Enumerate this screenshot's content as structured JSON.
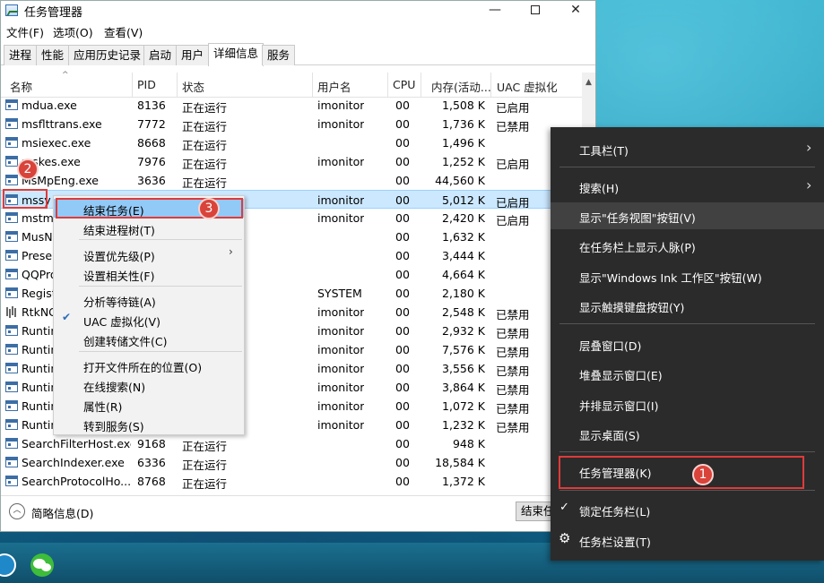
{
  "window": {
    "title": "任务管理器",
    "controls": {
      "minimize": "—",
      "maximize": "",
      "close": "✕"
    }
  },
  "menubar": [
    "文件(F)",
    "选项(O)",
    "查看(V)"
  ],
  "tabs": [
    "进程",
    "性能",
    "应用历史记录",
    "启动",
    "用户",
    "详细信息",
    "服务"
  ],
  "active_tab": "详细信息",
  "table": {
    "columns": [
      "名称",
      "PID",
      "状态",
      "用户名",
      "CPU",
      "内存(活动...",
      "UAC 虚拟化"
    ],
    "rows": [
      {
        "name": "mdua.exe",
        "pid": "8136",
        "status": "正在运行",
        "user": "imonitor",
        "cpu": "00",
        "mem": "1,508 K",
        "uac": "已启用"
      },
      {
        "name": "msflttrans.exe",
        "pid": "7772",
        "status": "正在运行",
        "user": "imonitor",
        "cpu": "00",
        "mem": "1,736 K",
        "uac": "已禁用"
      },
      {
        "name": "msiexec.exe",
        "pid": "8668",
        "status": "正在运行",
        "user": "",
        "cpu": "00",
        "mem": "1,496 K",
        "uac": ""
      },
      {
        "name": "mskes.exe",
        "pid": "7976",
        "status": "正在运行",
        "user": "imonitor",
        "cpu": "00",
        "mem": "1,252 K",
        "uac": "已启用"
      },
      {
        "name": "MsMpEng.exe",
        "pid": "3636",
        "status": "正在运行",
        "user": "",
        "cpu": "00",
        "mem": "44,560 K",
        "uac": ""
      },
      {
        "name": "mssy",
        "pid": "",
        "status": "",
        "user": "imonitor",
        "cpu": "00",
        "mem": "5,012 K",
        "uac": "已启用"
      },
      {
        "name": "mstm",
        "pid": "",
        "status": "",
        "user": "imonitor",
        "cpu": "00",
        "mem": "2,420 K",
        "uac": "已启用"
      },
      {
        "name": "MusN",
        "pid": "",
        "status": "",
        "user": "",
        "cpu": "00",
        "mem": "1,632 K",
        "uac": ""
      },
      {
        "name": "Presen",
        "pid": "",
        "status": "",
        "user": "",
        "cpu": "00",
        "mem": "3,444 K",
        "uac": ""
      },
      {
        "name": "QQPro",
        "pid": "",
        "status": "",
        "user": "",
        "cpu": "00",
        "mem": "4,664 K",
        "uac": ""
      },
      {
        "name": "Regist",
        "pid": "",
        "status": "",
        "user": "SYSTEM",
        "cpu": "00",
        "mem": "2,180 K",
        "uac": ""
      },
      {
        "name": "RtkNG",
        "pid": "",
        "status": "",
        "user": "imonitor",
        "cpu": "00",
        "mem": "2,548 K",
        "uac": "已禁用"
      },
      {
        "name": "Runtin",
        "pid": "",
        "status": "",
        "user": "imonitor",
        "cpu": "00",
        "mem": "2,932 K",
        "uac": "已禁用"
      },
      {
        "name": "Runtin",
        "pid": "",
        "status": "",
        "user": "imonitor",
        "cpu": "00",
        "mem": "7,576 K",
        "uac": "已禁用"
      },
      {
        "name": "Runtin",
        "pid": "",
        "status": "",
        "user": "imonitor",
        "cpu": "00",
        "mem": "3,556 K",
        "uac": "已禁用"
      },
      {
        "name": "Runtin",
        "pid": "",
        "status": "",
        "user": "imonitor",
        "cpu": "00",
        "mem": "3,864 K",
        "uac": "已禁用"
      },
      {
        "name": "Runtin",
        "pid": "",
        "status": "",
        "user": "imonitor",
        "cpu": "00",
        "mem": "1,072 K",
        "uac": "已禁用"
      },
      {
        "name": "Runtin",
        "pid": "",
        "status": "",
        "user": "imonitor",
        "cpu": "00",
        "mem": "1,232 K",
        "uac": "已禁用"
      },
      {
        "name": "SearchFilterHost.exe",
        "pid": "9168",
        "status": "正在运行",
        "user": "",
        "cpu": "00",
        "mem": "948 K",
        "uac": ""
      },
      {
        "name": "SearchIndexer.exe",
        "pid": "6336",
        "status": "正在运行",
        "user": "",
        "cpu": "00",
        "mem": "18,584 K",
        "uac": ""
      },
      {
        "name": "SearchProtocolHo...",
        "pid": "8768",
        "status": "正在运行",
        "user": "",
        "cpu": "00",
        "mem": "1,372 K",
        "uac": ""
      }
    ]
  },
  "footer": {
    "brief_label": "简略信息(D)",
    "end_task_label": "结束任务(E)"
  },
  "context_menu": {
    "items": [
      "结束任务(E)",
      "结束进程树(T)",
      "设置优先级(P)",
      "设置相关性(F)",
      "分析等待链(A)",
      "UAC 虚拟化(V)",
      "创建转储文件(C)",
      "打开文件所在的位置(O)",
      "在线搜索(N)",
      "属性(R)",
      "转到服务(S)"
    ],
    "highlighted": "结束任务(E)",
    "checked": "UAC 虚拟化(V)",
    "submenu": "设置优先级(P)"
  },
  "taskbar_menu": {
    "items": [
      "工具栏(T)",
      "搜索(H)",
      "显示\"任务视图\"按钮(V)",
      "在任务栏上显示人脉(P)",
      "显示\"Windows Ink 工作区\"按钮(W)",
      "显示触摸键盘按钮(Y)",
      "层叠窗口(D)",
      "堆叠显示窗口(E)",
      "并排显示窗口(I)",
      "显示桌面(S)",
      "任务管理器(K)",
      "锁定任务栏(L)",
      "任务栏设置(T)"
    ],
    "highlighted": "显示\"任务视图\"按钮(V)",
    "checked": "锁定任务栏(L)"
  },
  "annotations": {
    "step1": "1",
    "step2": "2",
    "step3": "3"
  },
  "colors": {
    "highlight_red": "#e03a3a",
    "badge_red": "#d9433a",
    "selected_row": "#cce8ff",
    "menu_highlight": "#91c9f7",
    "dark_menu": "#2b2b2b"
  }
}
